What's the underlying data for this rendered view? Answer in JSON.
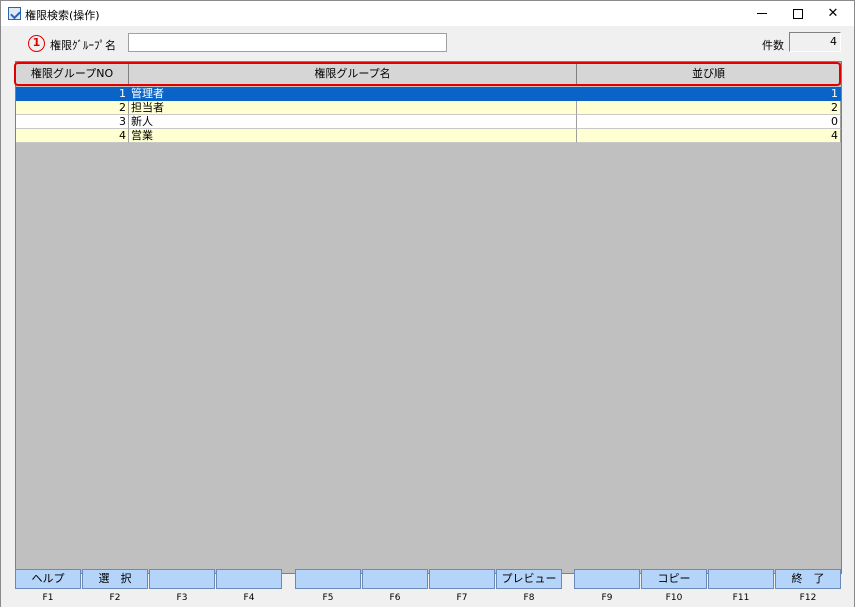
{
  "window": {
    "title": "権限検索(操作)"
  },
  "search": {
    "marker": "1",
    "label": "権限ｸﾞﾙｰﾌﾟ名",
    "value": "",
    "count_label": "件数",
    "count_value": "4"
  },
  "grid": {
    "columns": [
      "権限グループNO",
      "権限グループ名",
      "並び順"
    ],
    "rows": [
      {
        "no": "1",
        "name": "管理者",
        "order": "1",
        "state": "selected"
      },
      {
        "no": "2",
        "name": "担当者",
        "order": "2",
        "state": "alt"
      },
      {
        "no": "3",
        "name": "新人",
        "order": "0",
        "state": "plain"
      },
      {
        "no": "4",
        "name": "営業",
        "order": "4",
        "state": "alt"
      }
    ]
  },
  "fkeys": [
    {
      "label": "ヘルプ",
      "key": "F1"
    },
    {
      "label": "選　択",
      "key": "F2"
    },
    {
      "label": "",
      "key": "F3"
    },
    {
      "label": "",
      "key": "F4"
    },
    {
      "label": "",
      "key": "F5"
    },
    {
      "label": "",
      "key": "F6"
    },
    {
      "label": "",
      "key": "F7"
    },
    {
      "label": "プレビュー",
      "key": "F8"
    },
    {
      "label": "",
      "key": "F9"
    },
    {
      "label": "コピー",
      "key": "F10"
    },
    {
      "label": "",
      "key": "F11"
    },
    {
      "label": "終　了",
      "key": "F12"
    }
  ],
  "colors": {
    "selected_row": "#0a64c8",
    "alt_row": "#ffffd2",
    "highlight": "#e00000",
    "fkey_bg": "#b4d4fa"
  }
}
